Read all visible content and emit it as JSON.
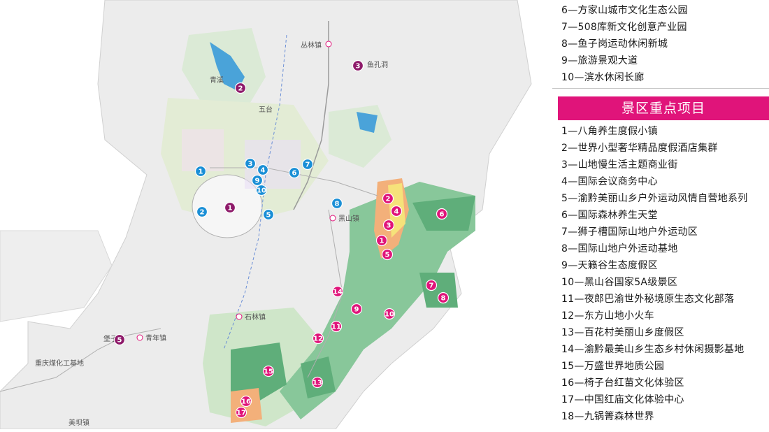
{
  "map": {
    "towns": {
      "conglin": "丛林镇",
      "heishan": "黑山镇",
      "shilin": "石林镇",
      "qingnian": "青年镇",
      "meishi": "美坝镇",
      "chemical_base": "重庆煤化工基地",
      "wuhu": "五台",
      "yukong": "鱼孔洞",
      "qingxi": "青溪",
      "baoshi": "堡子"
    },
    "colors": {
      "marker_purple": "#8e1a6a",
      "marker_blue": "#1a8fd6",
      "marker_pink": "#e0147a",
      "green_dark": "#5fae7a",
      "green_light": "#cfe6c9",
      "orange": "#f0a060",
      "yellow": "#f6e27a",
      "water": "#4aa3d9"
    },
    "purple_markers": [
      "1",
      "2",
      "3",
      "5"
    ],
    "blue_markers": [
      "1",
      "2",
      "3",
      "4",
      "5",
      "6",
      "7",
      "8",
      "9",
      "10"
    ],
    "pink_markers": [
      "1",
      "2",
      "3",
      "4",
      "5",
      "6",
      "7",
      "8",
      "9",
      "10",
      "11",
      "12",
      "13",
      "14",
      "15",
      "16",
      "17"
    ]
  },
  "legend": {
    "top_items": [
      "6—方家山城市文化生态公园",
      "7—508库新文化创意产业园",
      "8—鱼子岗运动休闲新城",
      "9—旅游景观大道",
      "10—滨水休闲长廊"
    ],
    "header": "景区重点项目",
    "items": [
      "1—八角养生度假小镇",
      "2—世界小型奢华精品度假酒店集群",
      "3—山地慢生活主题商业街",
      "4—国际会议商务中心",
      "5—渝黔美丽山乡户外运动风情自营地系列",
      "6—国际森林养生天堂",
      "7—狮子槽国际山地户外运动区",
      "8—国际山地户外运动基地",
      "9—天籁谷生态度假区",
      "10—黑山谷国家5A级景区",
      "11—夜郎巴渝世外秘境原生态文化部落",
      "12—东方山地小火车",
      "13—百花村美丽山乡度假区",
      "14—渝黔最美山乡生态乡村休闲摄影基地",
      "15—万盛世界地质公园",
      "16—椅子台红苗文化体验区",
      "17—中国红庙文化体验中心",
      "18—九锅箐森林世界"
    ]
  }
}
